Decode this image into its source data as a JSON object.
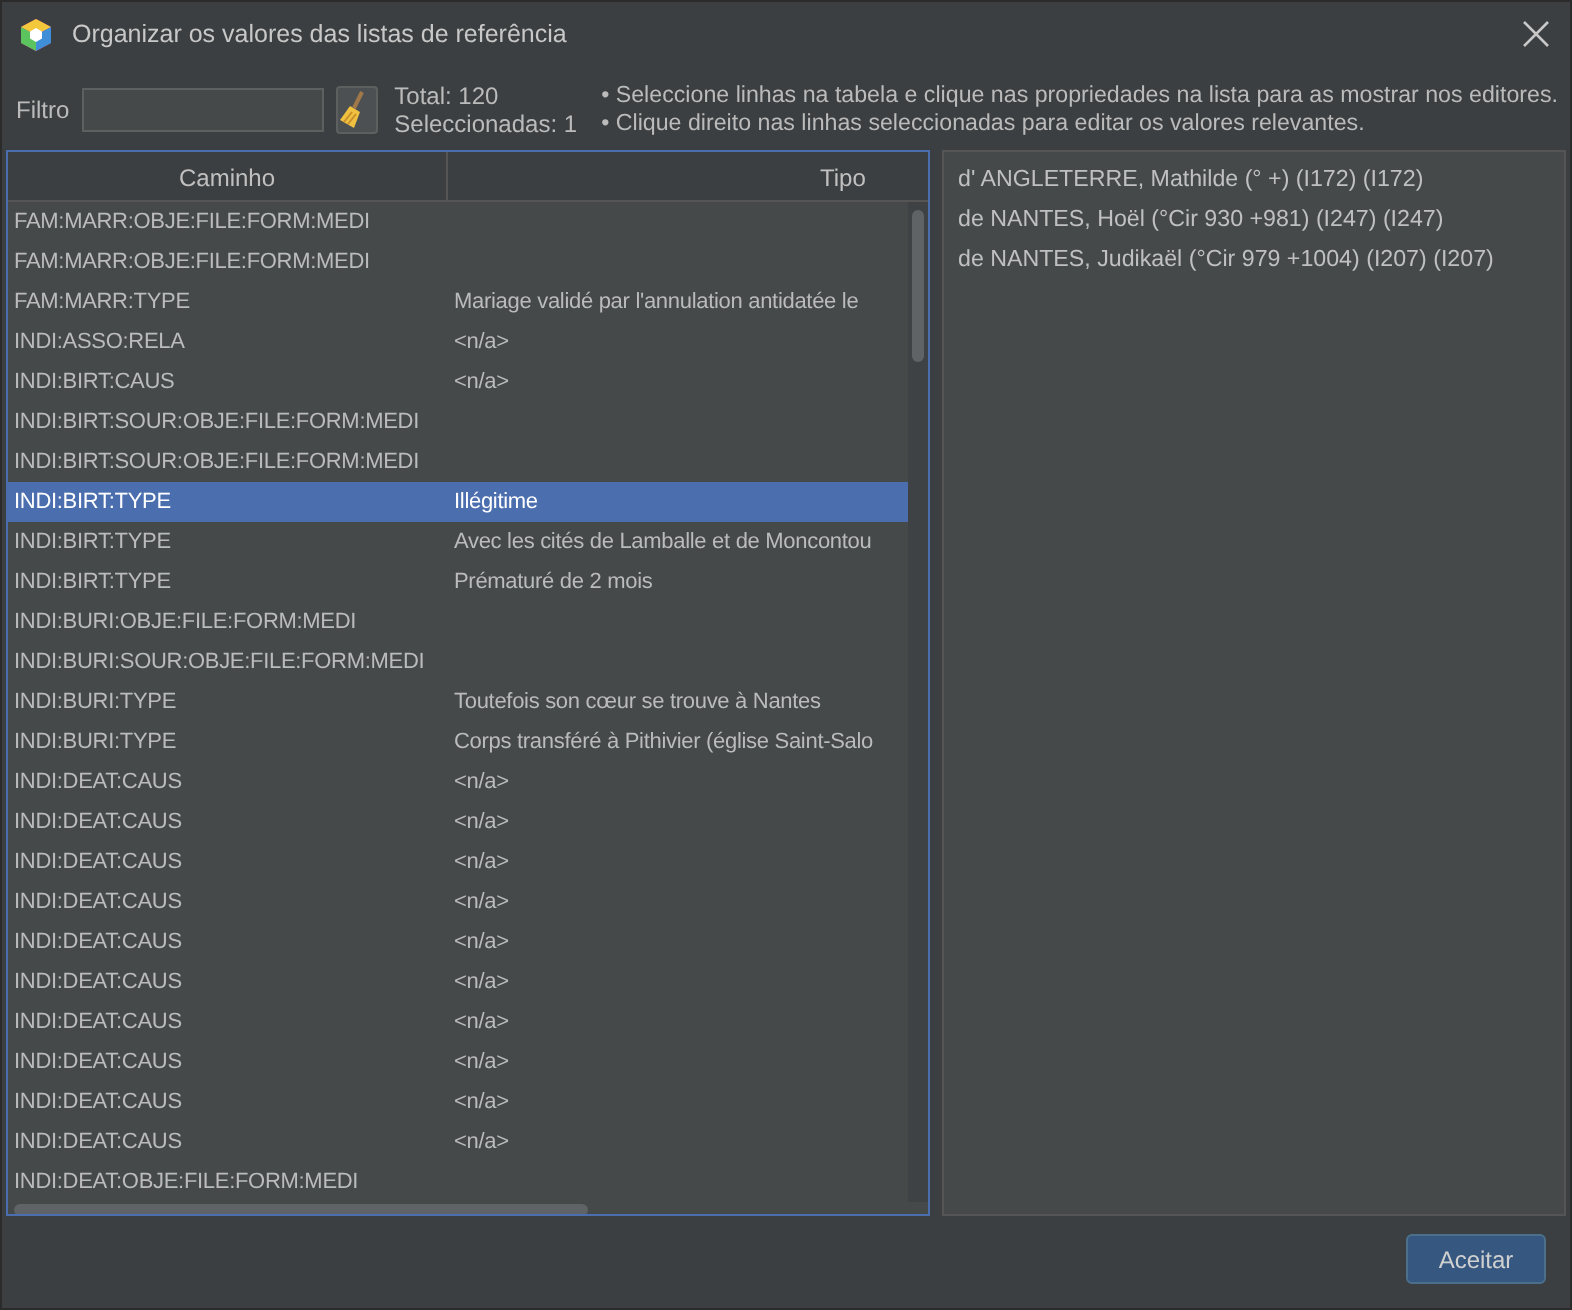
{
  "window": {
    "title": "Organizar os valores das listas de referência"
  },
  "toolbar": {
    "filter_label": "Filtro",
    "total": "Total: 120",
    "selected_count": "Seleccionadas: 1",
    "hints": [
      "• Seleccione linhas na tabela e clique nas propriedades na lista para as mostrar nos editores.",
      "• Clique direito nas linhas seleccionadas para editar os valores relevantes."
    ]
  },
  "table": {
    "columns": [
      "Caminho",
      "Tipo"
    ],
    "rows": [
      {
        "path": "FAM:MARR:OBJE:FILE:FORM:MEDI",
        "selected": false
      },
      {
        "path": "FAM:MARR:OBJE:FILE:FORM:MEDI",
        "selected": false
      },
      {
        "path": "FAM:MARR:TYPE",
        "type": "Mariage validé par l'annulation antidatée le",
        "selected": false
      },
      {
        "path": "INDI:ASSO:RELA",
        "type": "<n/a>",
        "selected": false
      },
      {
        "path": "INDI:BIRT:CAUS",
        "type": "<n/a>",
        "selected": false
      },
      {
        "path": "INDI:BIRT:SOUR:OBJE:FILE:FORM:MEDI",
        "selected": false
      },
      {
        "path": "INDI:BIRT:SOUR:OBJE:FILE:FORM:MEDI",
        "selected": false
      },
      {
        "path": "INDI:BIRT:TYPE",
        "type": "Illégitime",
        "selected": true
      },
      {
        "path": "INDI:BIRT:TYPE",
        "type": "Avec les cités de Lamballe et de Moncontou",
        "selected": false
      },
      {
        "path": "INDI:BIRT:TYPE",
        "type": "Prématuré de 2 mois",
        "selected": false
      },
      {
        "path": "INDI:BURI:OBJE:FILE:FORM:MEDI",
        "selected": false
      },
      {
        "path": "INDI:BURI:SOUR:OBJE:FILE:FORM:MEDI",
        "selected": false
      },
      {
        "path": "INDI:BURI:TYPE",
        "type": "Toutefois son cœur se trouve à Nantes",
        "selected": false
      },
      {
        "path": "INDI:BURI:TYPE",
        "type": "Corps transféré à Pithivier (église Saint-Salo",
        "selected": false
      },
      {
        "path": "INDI:DEAT:CAUS",
        "type": "<n/a>",
        "selected": false
      },
      {
        "path": "INDI:DEAT:CAUS",
        "type": "<n/a>",
        "selected": false
      },
      {
        "path": "INDI:DEAT:CAUS",
        "type": "<n/a>",
        "selected": false
      },
      {
        "path": "INDI:DEAT:CAUS",
        "type": "<n/a>",
        "selected": false
      },
      {
        "path": "INDI:DEAT:CAUS",
        "type": "<n/a>",
        "selected": false
      },
      {
        "path": "INDI:DEAT:CAUS",
        "type": "<n/a>",
        "selected": false
      },
      {
        "path": "INDI:DEAT:CAUS",
        "type": "<n/a>",
        "selected": false
      },
      {
        "path": "INDI:DEAT:CAUS",
        "type": "<n/a>",
        "selected": false
      },
      {
        "path": "INDI:DEAT:CAUS",
        "type": "<n/a>",
        "selected": false
      },
      {
        "path": "INDI:DEAT:CAUS",
        "type": "<n/a>",
        "selected": false
      },
      {
        "path": "INDI:DEAT:OBJE:FILE:FORM:MEDI",
        "selected": false
      }
    ]
  },
  "entities": [
    "d' ANGLETERRE, Mathilde (° +) (I172) (I172)",
    "de NANTES, Hoël (°Cir 930 +981) (I247) (I247)",
    "de NANTES, Judikaël (°Cir 979 +1004) (I207) (I207)"
  ],
  "buttons": [
    "Aceitar"
  ]
}
